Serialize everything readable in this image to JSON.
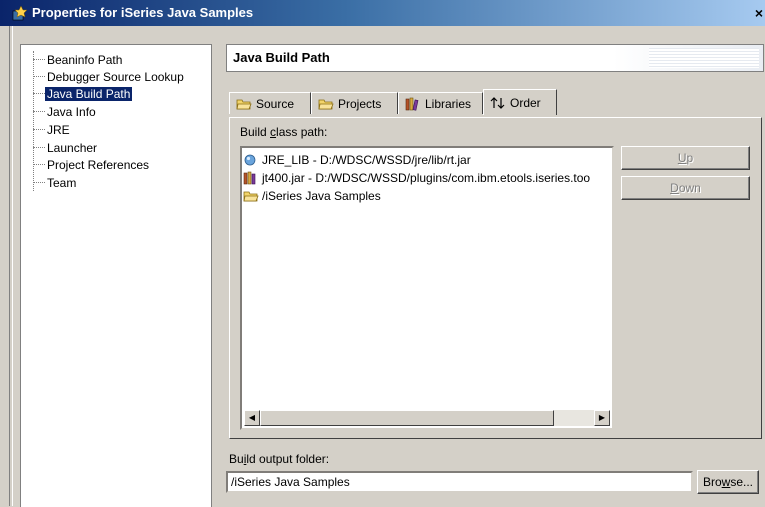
{
  "window": {
    "title": "Properties for iSeries Java Samples",
    "close_glyph": "×"
  },
  "nav": {
    "items": [
      {
        "label": "Beaninfo Path",
        "selected": false
      },
      {
        "label": "Debugger Source Lookup",
        "selected": false
      },
      {
        "label": "Java Build Path",
        "selected": true
      },
      {
        "label": "Java Info",
        "selected": false
      },
      {
        "label": "JRE",
        "selected": false
      },
      {
        "label": "Launcher",
        "selected": false
      },
      {
        "label": "Project References",
        "selected": false
      },
      {
        "label": "Team",
        "selected": false
      }
    ]
  },
  "page": {
    "title": "Java Build Path"
  },
  "tabs": [
    {
      "label": "Source",
      "icon": "folder-source-icon",
      "active": false
    },
    {
      "label": "Projects",
      "icon": "folder-projects-icon",
      "active": false
    },
    {
      "label": "Libraries",
      "icon": "libraries-icon",
      "active": false
    },
    {
      "label": "Order",
      "icon": "order-arrows-icon",
      "active": true
    }
  ],
  "order_tab": {
    "label_pre": "Build ",
    "label_mnemonic": "c",
    "label_post": "lass path:",
    "entries": [
      {
        "text": "JRE_LIB - D:/WDSC/WSSD/jre/lib/rt.jar",
        "icon": "variable-icon"
      },
      {
        "text": "jt400.jar - D:/WDSC/WSSD/plugins/com.ibm.etools.iseries.too",
        "icon": "jar-library-icon"
      },
      {
        "text": "/iSeries Java Samples",
        "icon": "project-folder-icon"
      }
    ],
    "up_mnemonic": "U",
    "up_rest": "p",
    "down_mnemonic": "D",
    "down_rest": "own",
    "scroll_left_glyph": "◀",
    "scroll_right_glyph": "▶"
  },
  "output": {
    "label_pre": "Bu",
    "label_mnemonic": "i",
    "label_post": "ld output folder:",
    "value": "/iSeries Java Samples",
    "browse_pre": "Bro",
    "browse_mnemonic": "w",
    "browse_post": "se..."
  },
  "colors": {
    "title_bar": "#0a246a",
    "selection": "#0a246a",
    "dialog_background": "#d4d0c8"
  }
}
